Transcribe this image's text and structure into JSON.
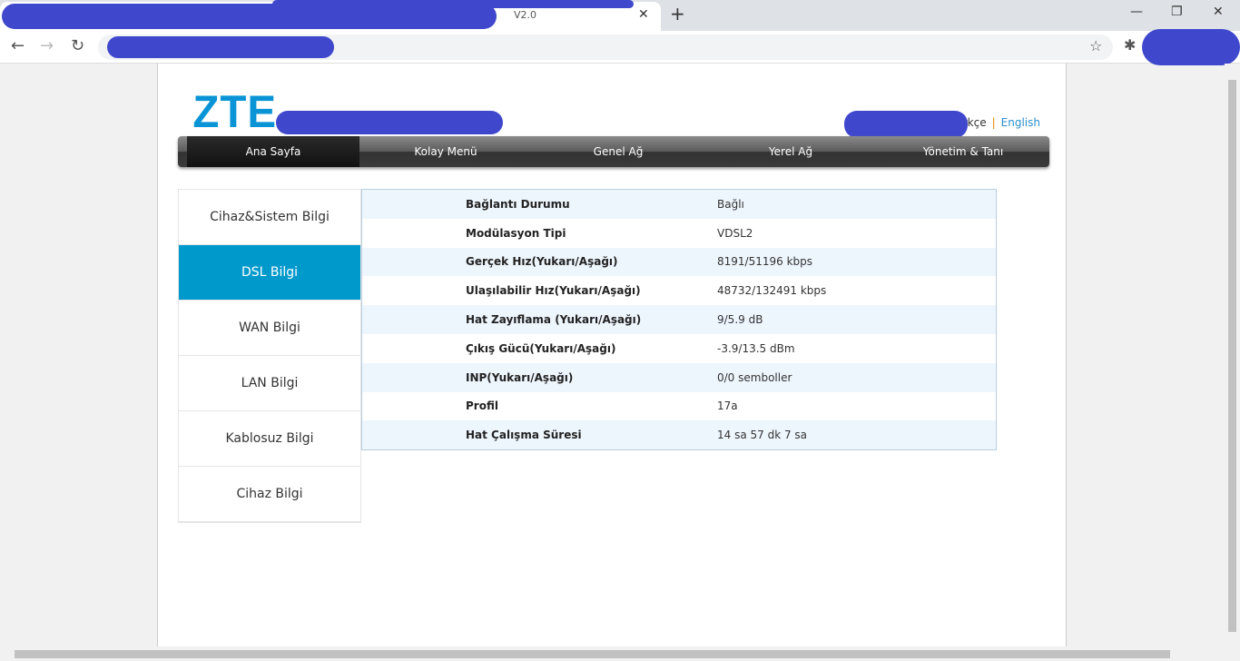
{
  "browser": {
    "tab_title": "V2.0",
    "close": "✕",
    "new_tab": "+",
    "minimize": "—",
    "restore": "❐",
    "close_window": "✕",
    "back": "←",
    "forward": "→",
    "reload": "↻",
    "star": "☆",
    "extensions": "✱"
  },
  "header": {
    "logo": "ZTE",
    "lang_partial": "rkçe",
    "lang_sep": "|",
    "lang_en": "English"
  },
  "nav": [
    "Ana Sayfa",
    "Kolay Menü",
    "Genel Ağ",
    "Yerel Ağ",
    "Yönetim & Tanı"
  ],
  "sidebar": [
    "Cihaz&Sistem Bilgi",
    "DSL Bilgi",
    "WAN Bilgi",
    "LAN Bilgi",
    "Kablosuz Bilgi",
    "Cihaz Bilgi"
  ],
  "dsl": [
    {
      "k": "Bağlantı Durumu",
      "v": "Bağlı"
    },
    {
      "k": "Modülasyon Tipi",
      "v": "VDSL2"
    },
    {
      "k": "Gerçek Hız(Yukarı/Aşağı)",
      "v": "8191/51196 kbps"
    },
    {
      "k": "Ulaşılabilir Hız(Yukarı/Aşağı)",
      "v": "48732/132491 kbps"
    },
    {
      "k": "Hat Zayıflama (Yukarı/Aşağı)",
      "v": "9/5.9 dB"
    },
    {
      "k": "Çıkış Gücü(Yukarı/Aşağı)",
      "v": "-3.9/13.5 dBm"
    },
    {
      "k": "INP(Yukarı/Aşağı)",
      "v": "0/0 semboller"
    },
    {
      "k": "Profil",
      "v": "17a"
    },
    {
      "k": "Hat Çalışma Süresi",
      "v": "14 sa 57 dk 7 sa"
    }
  ],
  "colors": {
    "accent": "#0099cc",
    "logo": "#0a94d6",
    "redaction": "#3f48cc"
  }
}
